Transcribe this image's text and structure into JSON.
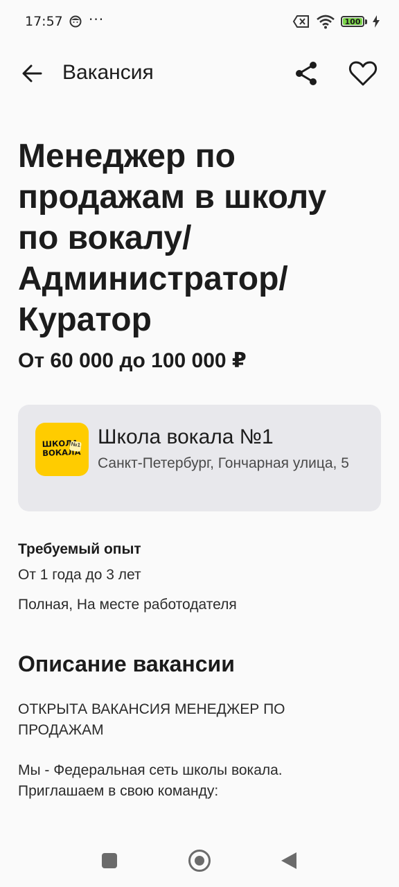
{
  "status_bar": {
    "time": "17:57",
    "dots": "···",
    "battery_level": "100"
  },
  "header": {
    "title": "Вакансия"
  },
  "job": {
    "title": "Менеджер по продажам в школу по вокалу/ Администратор/ Куратор",
    "salary": "От 60 000 до 100 000 ₽"
  },
  "company": {
    "logo_text_line1": "ШКОЛА",
    "logo_text_line2": "ВОКАЛА",
    "logo_badge": "№1",
    "name": "Школа вокала №1",
    "address": "Санкт-Петербург, Гончарная улица, 5"
  },
  "details": {
    "experience_label": "Требуемый опыт",
    "experience_value": "От 1 года до 3 лет",
    "schedule": "Полная, На месте работодателя"
  },
  "description": {
    "heading": "Описание вакансии",
    "paragraph1": "ОТКРЫТА ВАКАНСИЯ МЕНЕДЖЕР ПО ПРОДАЖАМ",
    "paragraph2": "Мы - Федеральная сеть школы вокала. Приглашаем в свою команду:"
  },
  "colors": {
    "accent_logo": "#ffcc00",
    "card_bg": "#e8e8ec",
    "battery_green": "#7cd64a"
  },
  "icons": [
    "back-arrow-icon",
    "share-icon",
    "heart-icon",
    "wifi-icon",
    "battery-icon",
    "sim-off-icon",
    "charging-icon"
  ]
}
